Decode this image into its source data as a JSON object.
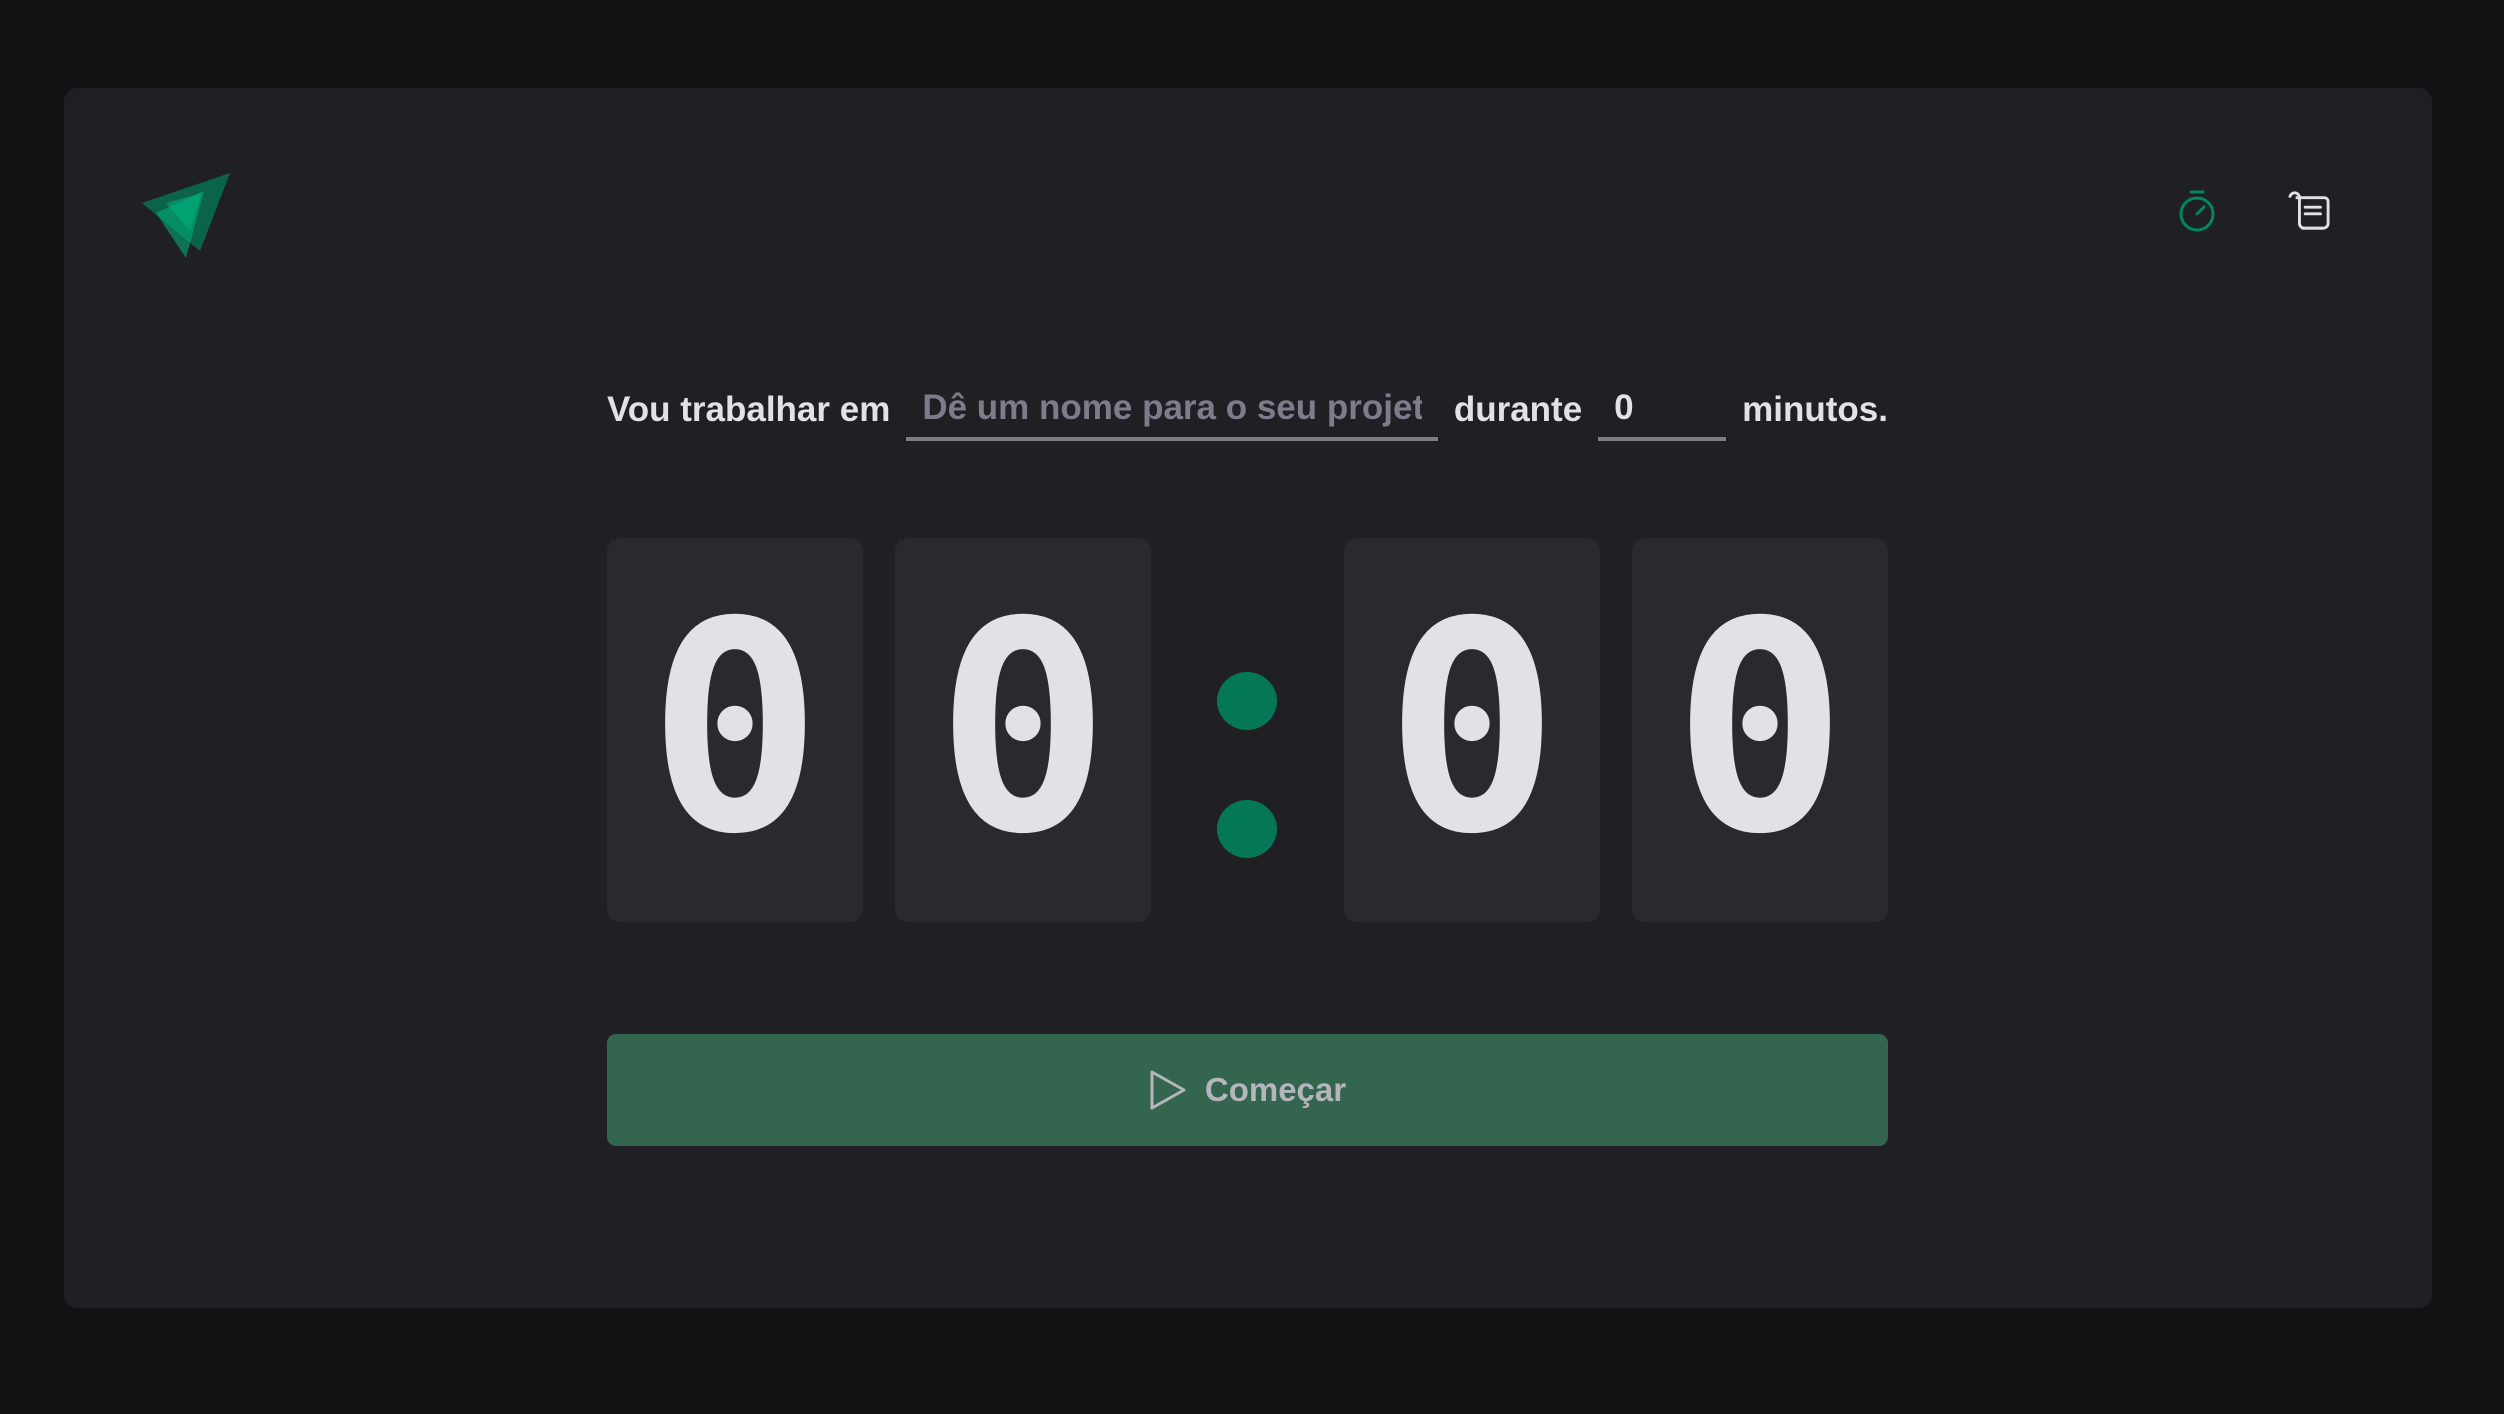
{
  "header": {
    "logo_icon": "ignite-timer-logo",
    "nav": [
      {
        "icon": "timer-icon",
        "active": true
      },
      {
        "icon": "scroll-history-icon",
        "active": false
      }
    ]
  },
  "form": {
    "task_label": "Vou trabalhar em",
    "task_value": "",
    "task_placeholder": "Dê um nome para o seu projeto",
    "during_label": "durante",
    "minutes_value": "0",
    "minutes_label": "minutos."
  },
  "countdown": {
    "minute_tens": "0",
    "minute_ones": "0",
    "second_tens": "0",
    "second_ones": "0"
  },
  "start_button": {
    "label": "Começar",
    "icon": "play-icon",
    "disabled": true
  },
  "colors": {
    "accent": "#00875F",
    "button_bg": "#33654F",
    "panel_bg": "#202024",
    "page_bg": "#121214",
    "digit_bg": "#29292E",
    "text": "#E1E1E6",
    "placeholder": "#7C7C8A"
  }
}
